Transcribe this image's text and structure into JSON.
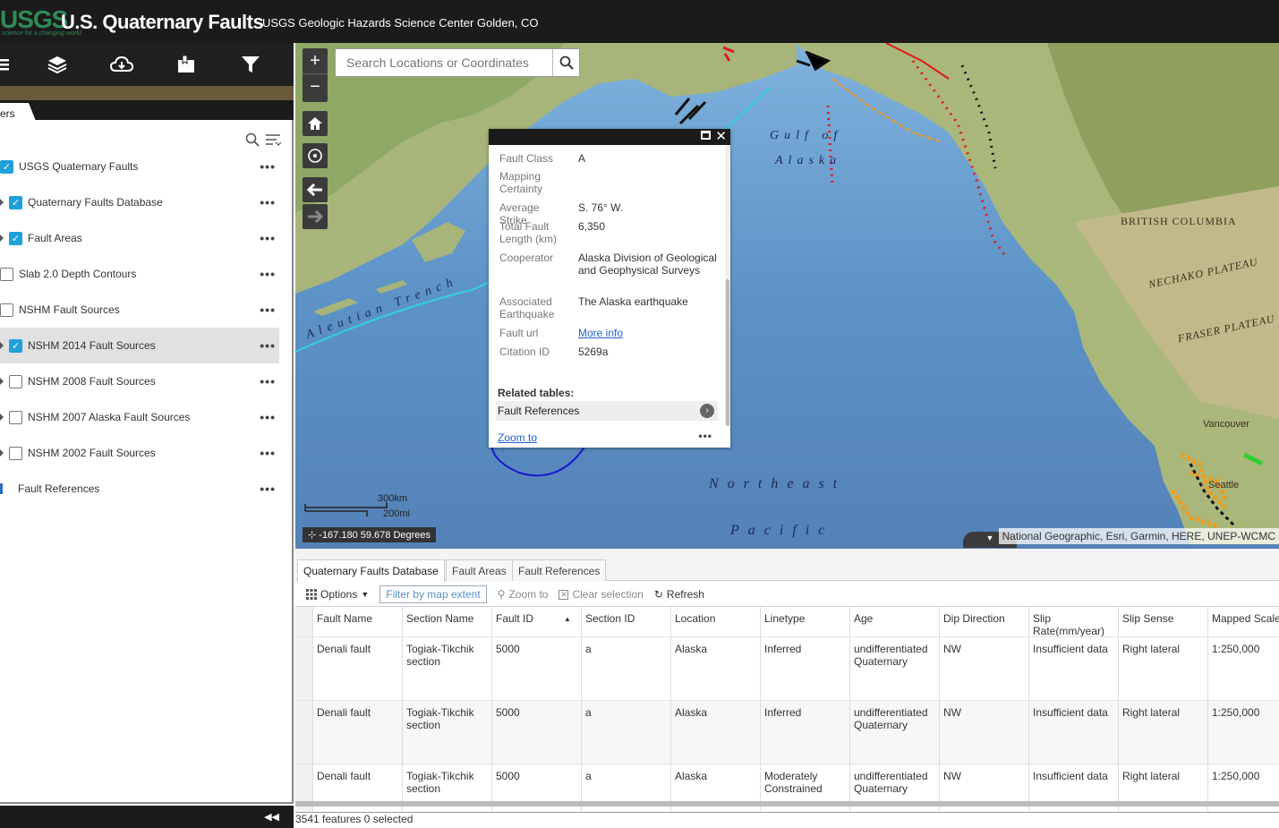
{
  "header": {
    "logo": "USGS",
    "logo_tagline": "science for a changing world",
    "title": "U.S. Quaternary Faults",
    "subtitle": "USGS Geologic Hazards Science Center Golden, CO"
  },
  "left_panel": {
    "active_tab": "ers",
    "layers": [
      {
        "label": "USGS Quaternary Faults",
        "checked": true,
        "expandable": false,
        "indent": 0
      },
      {
        "label": "Quaternary Faults Database",
        "checked": true,
        "expandable": true,
        "indent": 1
      },
      {
        "label": "Fault Areas",
        "checked": true,
        "expandable": true,
        "indent": 1
      },
      {
        "label": "Slab 2.0 Depth Contours",
        "checked": false,
        "expandable": false,
        "indent": 0
      },
      {
        "label": "NSHM Fault Sources",
        "checked": false,
        "expandable": false,
        "indent": 0
      },
      {
        "label": "NSHM 2014 Fault Sources",
        "checked": true,
        "expandable": true,
        "indent": 1,
        "selected": true
      },
      {
        "label": "NSHM 2008 Fault Sources",
        "checked": false,
        "expandable": true,
        "indent": 1
      },
      {
        "label": "NSHM 2007 Alaska Fault Sources",
        "checked": false,
        "expandable": true,
        "indent": 1
      },
      {
        "label": "NSHM 2002 Fault Sources",
        "checked": false,
        "expandable": true,
        "indent": 1
      },
      {
        "label": "Fault References",
        "table": true,
        "indent": 0
      }
    ],
    "more_glyph": "•••"
  },
  "map": {
    "search_placeholder": "Search Locations or Coordinates",
    "labels": {
      "gulf1": "Gulf of",
      "gulf2": "Alaska",
      "northeast": "Northeast",
      "pacific": "Pacific",
      "trench": "Aleutian Trench",
      "bc": "BRITISH COLUMBIA",
      "nechako": "NECHAKO PLATEAU",
      "fraser": "FRASER PLATEAU",
      "vancouver": "Vancouver",
      "seattle": "Seattle"
    },
    "scale_km": "300km",
    "scale_mi": "200mi",
    "coordinates": "-167.180 59.678 Degrees",
    "attribution": "National Geographic, Esri, Garmin, HERE, UNEP-WCMC"
  },
  "popup": {
    "attributes": [
      {
        "key": "Fault Class",
        "value": "A"
      },
      {
        "key": "Mapping Certainty",
        "value": ""
      },
      {
        "key": "Average Strike",
        "value": "S. 76° W."
      },
      {
        "key": "Total Fault Length (km)",
        "value": "6,350"
      },
      {
        "key": "Cooperator",
        "value": "Alaska Division of Geological and Geophysical Surveys"
      },
      {
        "key": "Associated Earthquake",
        "value": "The Alaska earthquake"
      },
      {
        "key": "Fault url",
        "value": "More info",
        "link": true
      },
      {
        "key": "Citation ID",
        "value": "5269a"
      }
    ],
    "related_title": "Related tables:",
    "related_item": "Fault References",
    "zoom_to": "Zoom to",
    "more": "•••"
  },
  "table": {
    "tabs": [
      "Quaternary Faults Database",
      "Fault Areas",
      "Fault References"
    ],
    "tools": {
      "options": "Options",
      "filter": "Filter by map extent",
      "zoom": "Zoom to",
      "clear": "Clear selection",
      "refresh": "Refresh"
    },
    "columns": [
      "Fault Name",
      "Section Name",
      "Fault ID",
      "Section ID",
      "Location",
      "Linetype",
      "Age",
      "Dip Direction",
      "Slip Rate(mm/year)",
      "Slip Sense",
      "Mapped Scale"
    ],
    "rows": [
      [
        "Denali fault",
        "Togiak-Tikchik section",
        "5000",
        "a",
        "Alaska",
        "Inferred",
        "undifferentiated Quaternary",
        "NW",
        "Insufficient data",
        "Right lateral",
        "1:250,000"
      ],
      [
        "Denali fault",
        "Togiak-Tikchik section",
        "5000",
        "a",
        "Alaska",
        "Inferred",
        "undifferentiated Quaternary",
        "NW",
        "Insufficient data",
        "Right lateral",
        "1:250,000"
      ],
      [
        "Denali fault",
        "Togiak-Tikchik section",
        "5000",
        "a",
        "Alaska",
        "Moderately Constrained",
        "undifferentiated Quaternary",
        "NW",
        "Insufficient data",
        "Right lateral",
        "1:250,000"
      ]
    ],
    "status": "3541 features 0 selected"
  },
  "colors": {
    "accent": "#1fa0d8",
    "header_bg": "#1b1b1b",
    "ocean": "#5a8fc2",
    "land": "#a9b77a",
    "annotation": "#1a1acc"
  }
}
